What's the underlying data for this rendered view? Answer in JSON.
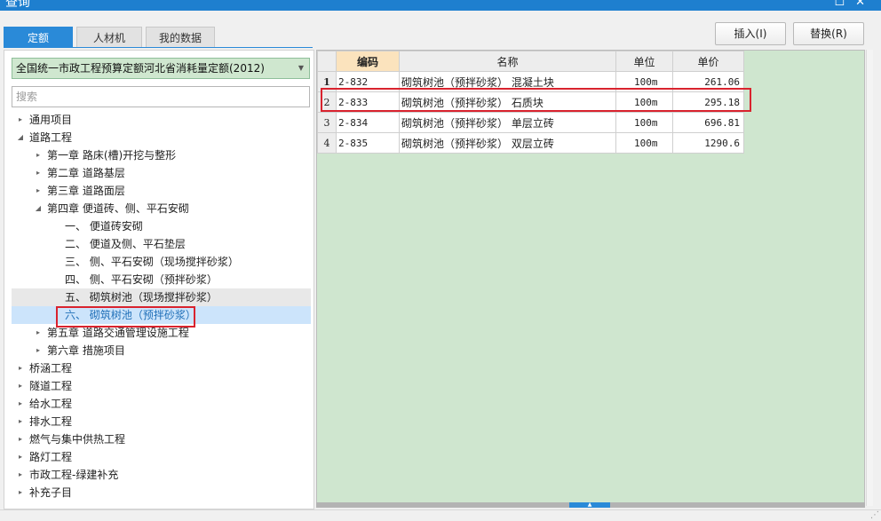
{
  "window": {
    "title": "查询",
    "controls": [
      "☐",
      "✕"
    ]
  },
  "tabs": [
    {
      "label": "定额",
      "active": true
    },
    {
      "label": "人材机",
      "active": false
    },
    {
      "label": "我的数据",
      "active": false
    }
  ],
  "buttons": {
    "insert": "插入(I)",
    "replace": "替换(R)"
  },
  "left": {
    "quota_select": "全国统一市政工程预算定额河北省消耗量定额(2012)",
    "search_placeholder": "搜索",
    "tree": [
      {
        "label": "通用项目",
        "level": 0,
        "caret": "▸"
      },
      {
        "label": "道路工程",
        "level": 0,
        "caret": "◢"
      },
      {
        "label": "第一章 路床(槽)开挖与整形",
        "level": 1,
        "caret": "▸"
      },
      {
        "label": "第二章 道路基层",
        "level": 1,
        "caret": "▸"
      },
      {
        "label": "第三章 道路面层",
        "level": 1,
        "caret": "▸"
      },
      {
        "label": "第四章 便道砖、侧、平石安砌",
        "level": 1,
        "caret": "◢"
      },
      {
        "label": "一、 便道砖安砌",
        "level": 2,
        "caret": ""
      },
      {
        "label": "二、 便道及侧、平石垫层",
        "level": 2,
        "caret": ""
      },
      {
        "label": "三、 侧、平石安砌（现场搅拌砂浆）",
        "level": 2,
        "caret": ""
      },
      {
        "label": "四、 侧、平石安砌（预拌砂浆）",
        "level": 2,
        "caret": ""
      },
      {
        "label": "五、 砌筑树池（现场搅拌砂浆）",
        "level": 2,
        "caret": "",
        "state": "hover"
      },
      {
        "label": "六、 砌筑树池（预拌砂浆）",
        "level": 2,
        "caret": "",
        "state": "selected"
      },
      {
        "label": "第五章 道路交通管理设施工程",
        "level": 1,
        "caret": "▸"
      },
      {
        "label": "第六章 措施项目",
        "level": 1,
        "caret": "▸"
      },
      {
        "label": "桥涵工程",
        "level": 0,
        "caret": "▸"
      },
      {
        "label": "隧道工程",
        "level": 0,
        "caret": "▸"
      },
      {
        "label": "给水工程",
        "level": 0,
        "caret": "▸"
      },
      {
        "label": "排水工程",
        "level": 0,
        "caret": "▸"
      },
      {
        "label": "燃气与集中供热工程",
        "level": 0,
        "caret": "▸"
      },
      {
        "label": "路灯工程",
        "level": 0,
        "caret": "▸"
      },
      {
        "label": "市政工程-绿建补充",
        "level": 0,
        "caret": "▸"
      },
      {
        "label": "补充子目",
        "level": 0,
        "caret": "▸"
      }
    ]
  },
  "grid": {
    "headers": {
      "code": "编码",
      "name": "名称",
      "unit": "单位",
      "price": "单价"
    },
    "rows": [
      {
        "num": "1",
        "code": "2-832",
        "name": "砌筑树池（预拌砂浆） 混凝土块",
        "unit": "100m",
        "price": "261.06",
        "active": true
      },
      {
        "num": "2",
        "code": "2-833",
        "name": "砌筑树池（预拌砂浆） 石质块",
        "unit": "100m",
        "price": "295.18"
      },
      {
        "num": "3",
        "code": "2-834",
        "name": "砌筑树池（预拌砂浆） 单层立砖",
        "unit": "100m",
        "price": "696.81"
      },
      {
        "num": "4",
        "code": "2-835",
        "name": "砌筑树池（预拌砂浆） 双层立砖",
        "unit": "100m",
        "price": "1290.6"
      }
    ]
  },
  "colors": {
    "accent": "#2a8ad8",
    "title_bar": "#1e7fcf",
    "grid_background": "#cfe6cf",
    "highlight": "#d9232e",
    "selected_row": "#cce4fb"
  }
}
